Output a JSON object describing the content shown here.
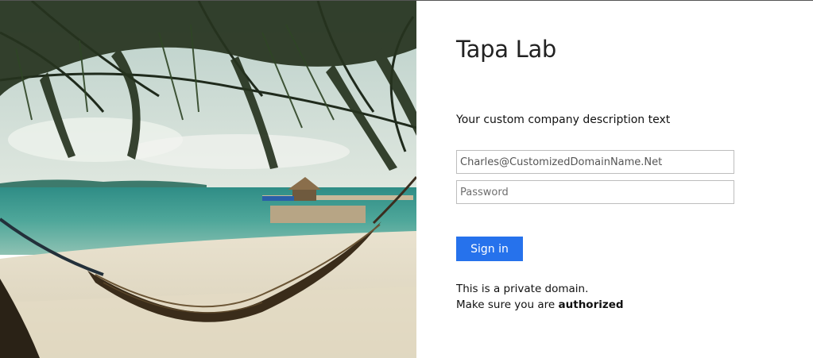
{
  "illustration": {
    "icon": "beach-hammock-photo"
  },
  "login": {
    "title": "Tapa Lab",
    "description": "Your custom company description text",
    "email_value": "Charles@CustomizedDomainName.Net",
    "password_placeholder": "Password",
    "signin_label": "Sign in",
    "notice_line1": "This is a private domain.",
    "notice_line2_prefix": "Make sure you are ",
    "notice_line2_bold": "authorized"
  },
  "colors": {
    "accent": "#2672ec"
  }
}
